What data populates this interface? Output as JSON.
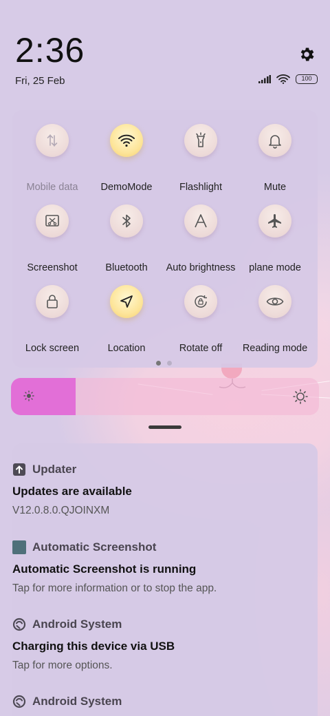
{
  "status": {
    "time": "2:36",
    "date": "Fri, 25 Feb",
    "battery": "100"
  },
  "quick_settings": {
    "tiles": [
      {
        "label": "Mobile data",
        "icon": "mobile-data-icon",
        "active": false,
        "dim": true
      },
      {
        "label": "DemoMode",
        "icon": "wifi-icon",
        "active": true,
        "dim": false
      },
      {
        "label": "Flashlight",
        "icon": "flashlight-icon",
        "active": false,
        "dim": false
      },
      {
        "label": "Mute",
        "icon": "bell-icon",
        "active": false,
        "dim": false
      },
      {
        "label": "Screenshot",
        "icon": "screenshot-icon",
        "active": false,
        "dim": false
      },
      {
        "label": "Bluetooth",
        "icon": "bluetooth-icon",
        "active": false,
        "dim": false
      },
      {
        "label": "Auto brightness",
        "icon": "auto-brightness-icon",
        "active": false,
        "dim": false
      },
      {
        "label": "plane mode",
        "icon": "airplane-icon",
        "active": false,
        "dim": false
      },
      {
        "label": "Lock screen",
        "icon": "lock-icon",
        "active": false,
        "dim": false
      },
      {
        "label": "Location",
        "icon": "location-icon",
        "active": true,
        "dim": false
      },
      {
        "label": "Rotate off",
        "icon": "rotation-lock-icon",
        "active": false,
        "dim": false
      },
      {
        "label": "Reading mode",
        "icon": "eye-icon",
        "active": false,
        "dim": false
      }
    ],
    "page": 1,
    "pages": 2
  },
  "brightness": {
    "level": 0.21
  },
  "colors": {
    "accent": "#e26fd7",
    "active_tile": "#fde59a",
    "background": "#d6c9e6"
  },
  "notifications": [
    {
      "app": "Updater",
      "title": "Updates are available",
      "body": "V12.0.8.0.QJOINXM",
      "icon": "update-arrow-icon"
    },
    {
      "app": "Automatic Screenshot",
      "title": "Automatic Screenshot is running",
      "body": "Tap for more information or to stop the app.",
      "icon": "app-square-icon"
    },
    {
      "app": "Android System",
      "title": "Charging this device via USB",
      "body": "Tap for more options.",
      "icon": "android-system-icon"
    },
    {
      "app": "Android System",
      "title": "",
      "body": "",
      "icon": "android-system-icon"
    }
  ]
}
